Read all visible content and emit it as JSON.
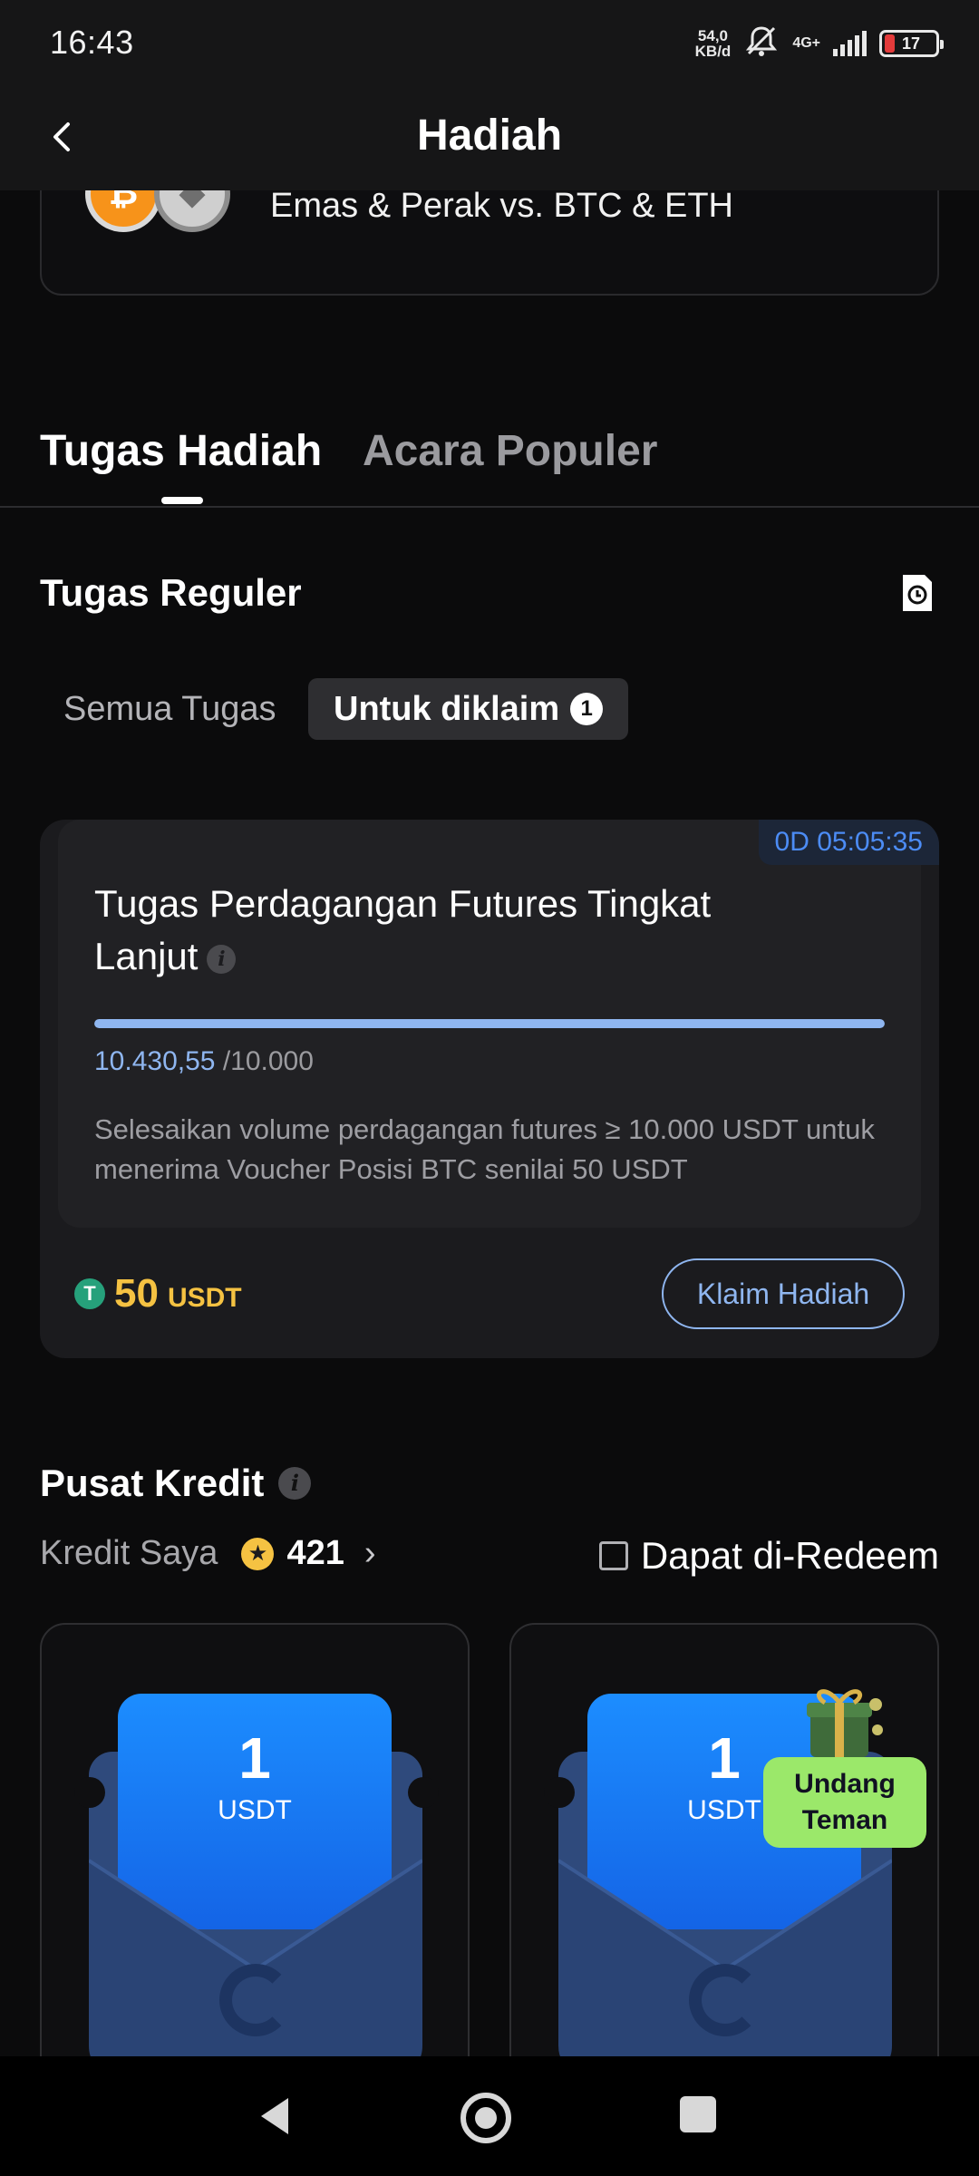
{
  "status_bar": {
    "time": "16:43",
    "net_speed_value": "54,0",
    "net_speed_unit": "KB/d",
    "network_type": "4G+",
    "battery_level": "17"
  },
  "header": {
    "title": "Hadiah"
  },
  "top_card": {
    "text": "Emas & Perak vs. BTC & ETH"
  },
  "main_tabs": [
    {
      "label": "Tugas Hadiah",
      "active": true
    },
    {
      "label": "Acara Populer",
      "active": false
    }
  ],
  "regular_tasks": {
    "title": "Tugas Reguler",
    "sub_tabs": {
      "all_label": "Semua Tugas",
      "claim_label": "Untuk diklaim",
      "claim_count": "1"
    }
  },
  "task_card": {
    "timer": "0D 05:05:35",
    "title": "Tugas Perdagangan Futures Tingkat Lanjut",
    "progress_current": "10.430,55",
    "progress_target": "/10.000",
    "progress_fraction": 1.0,
    "description": "Selesaikan volume perdagangan futures ≥ 10.000 USDT untuk menerima Voucher Posisi BTC senilai 50 USDT",
    "reward_amount": "50",
    "reward_unit": "USDT",
    "claim_button": "Klaim Hadiah"
  },
  "credit_center": {
    "title": "Pusat Kredit",
    "my_credit_label": "Kredit Saya",
    "my_credit_value": "421",
    "redeemable_label": "Dapat di-Redeem",
    "vouchers": [
      {
        "amount": "1",
        "unit": "USDT"
      },
      {
        "amount": "1",
        "unit": "USDT"
      }
    ],
    "invite_badge": "Undang Teman"
  },
  "colors": {
    "accent_blue": "#8fb6f0",
    "reward_gold": "#f5c242",
    "invite_green": "#9be86a"
  }
}
